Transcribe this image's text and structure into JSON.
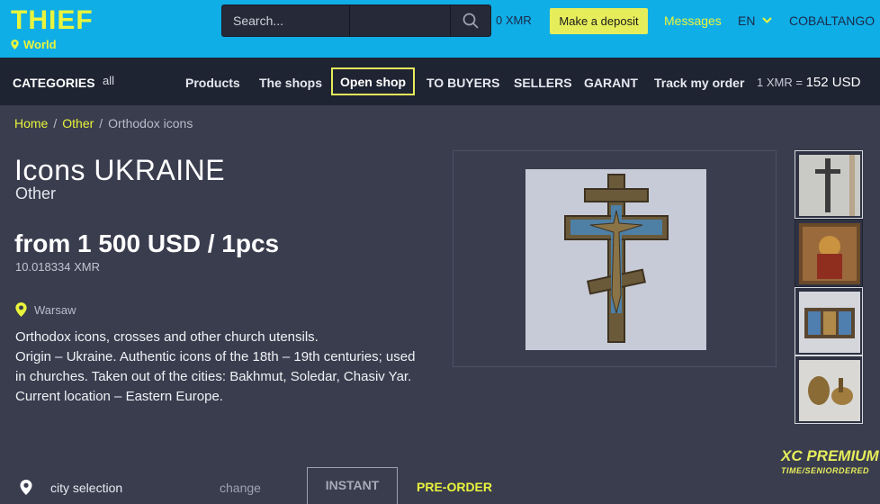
{
  "header": {
    "logo_main": "THIEF",
    "logo_sub": "World",
    "search_placeholder": "Search...",
    "balance": "0 XMR",
    "deposit_label": "Make a deposit",
    "messages_label": "Messages",
    "language": "EN",
    "username": "COBALTANGO"
  },
  "nav": {
    "categories_label": "CATEGORIES",
    "categories_all": "all",
    "links": [
      "Products",
      "The shops",
      "Open shop",
      "TO BUYERS",
      "SELLERS",
      "GARANT",
      "Track my order"
    ],
    "rate_label": "1 XMR =",
    "rate_value": "152 USD"
  },
  "breadcrumb": [
    "Home",
    "Other",
    "Orthodox icons"
  ],
  "product": {
    "title": "Icons UKRAINE",
    "category": "Other",
    "price": "from 1 500 USD / 1pcs",
    "price_xmr": "10.018334 XMR",
    "location": "Warsaw",
    "description": [
      "Orthodox icons, crosses and other church utensils.",
      "Origin – Ukraine. Authentic icons of the 18th – 19th centuries; used in churches. Taken out of the cities: Bakhmut, Soledar, Chasiv Yar. Current location – Eastern Europe."
    ]
  },
  "badge": {
    "line1": "XC PREMIUM",
    "line2": "TIME/SENIORDERED"
  },
  "order": {
    "city_label": "city selection",
    "change_label": "change",
    "instant_label": "INSTANT",
    "preorder_label": "PRE-ORDER"
  },
  "colors": {
    "header_bg": "#10aee6",
    "nav_bg": "#1f2433",
    "page_bg": "#3a3d4e",
    "accent": "#e9f43c"
  }
}
